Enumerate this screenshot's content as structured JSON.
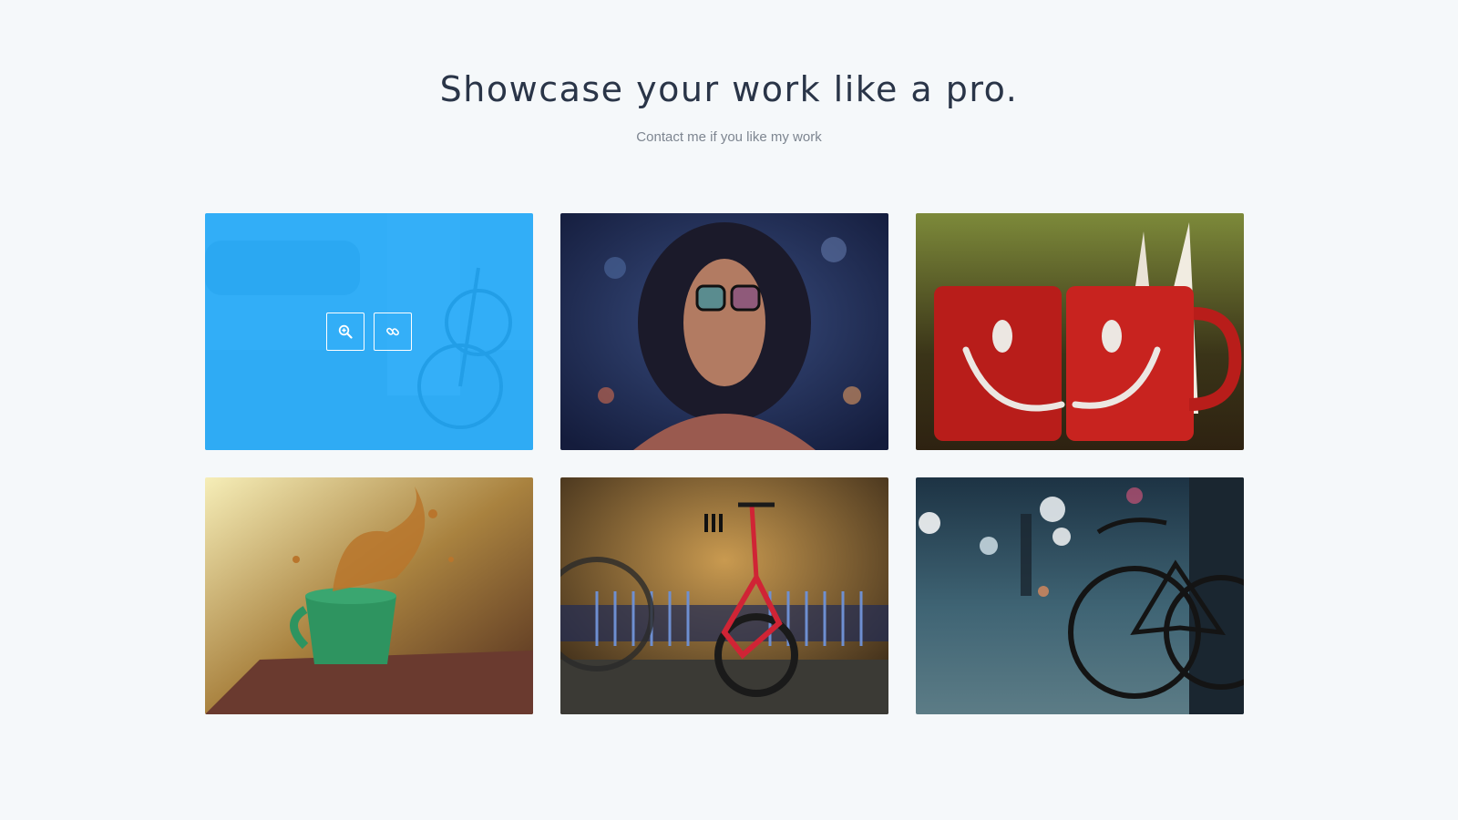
{
  "hero": {
    "title": "Showcase your work like a pro.",
    "subtitle": "Contact me if you like my work"
  },
  "portfolio": {
    "items": [
      {
        "subject": "street-bicycle",
        "hovered": true
      },
      {
        "subject": "woman-sunglasses-bokeh",
        "hovered": false
      },
      {
        "subject": "red-smiley-mugs-book",
        "hovered": false
      },
      {
        "subject": "green-cup-splash",
        "hovered": false
      },
      {
        "subject": "red-bicycle-wall",
        "hovered": false
      },
      {
        "subject": "bicycle-street-bokeh",
        "hovered": false
      }
    ],
    "overlay": {
      "color": "#18a6fa",
      "zoom_icon": "zoom-in-icon",
      "link_icon": "link-icon"
    }
  }
}
